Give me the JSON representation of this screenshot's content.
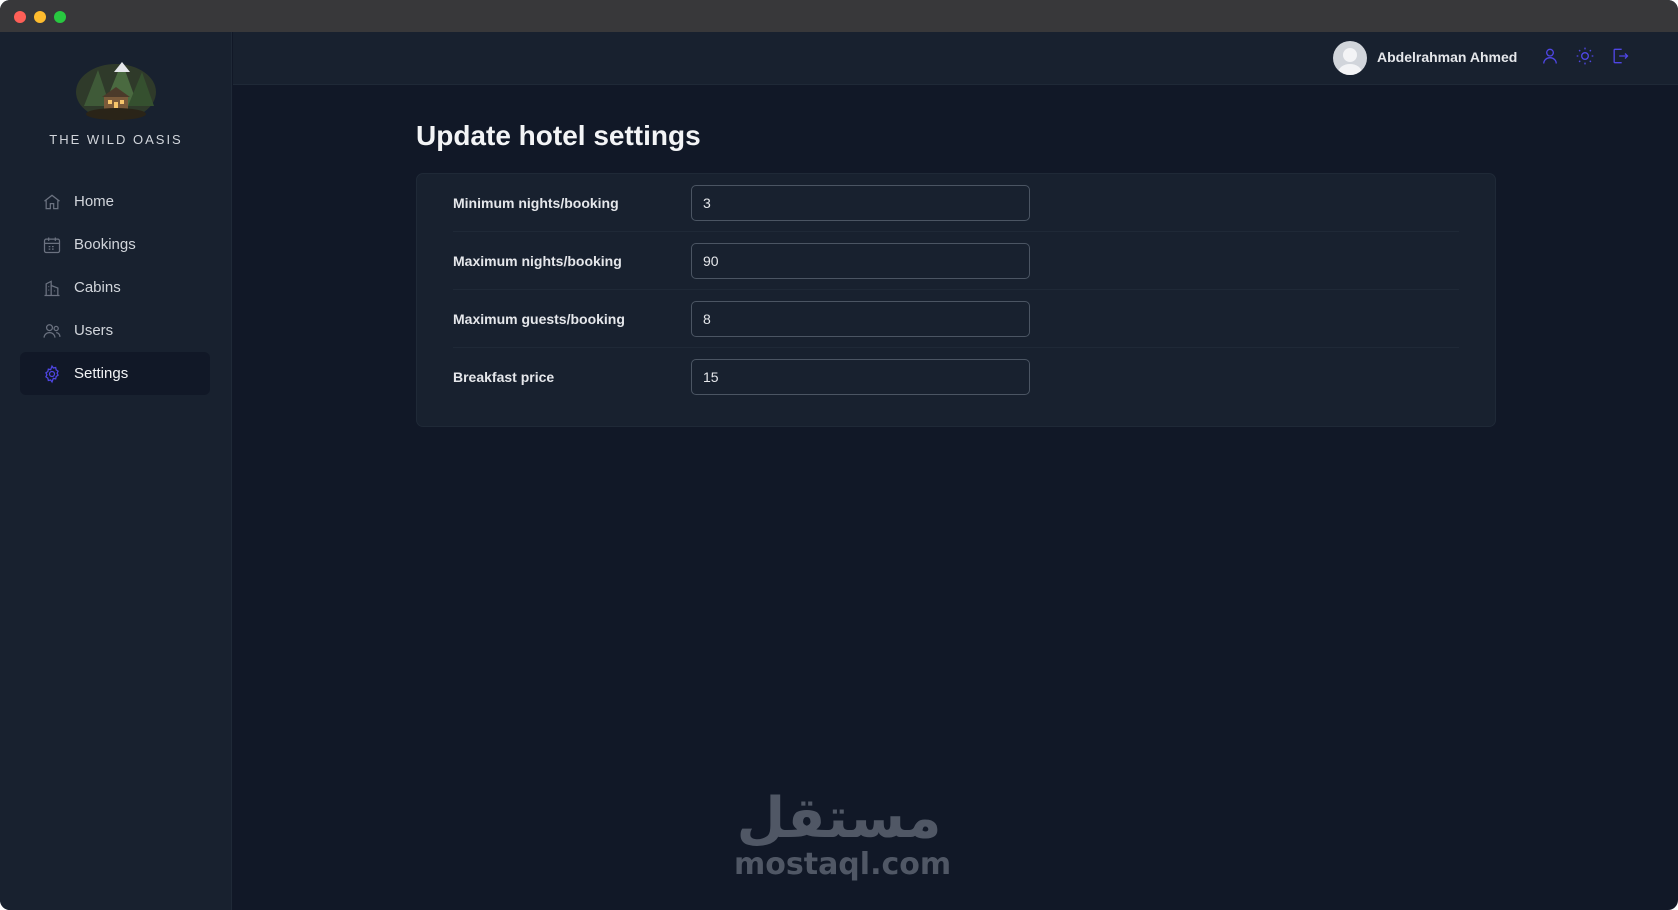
{
  "window": {
    "controls": [
      "close",
      "minimize",
      "maximize"
    ]
  },
  "sidebar": {
    "brand": "THE WILD OASIS",
    "items": [
      {
        "label": "Home",
        "icon": "home-icon",
        "active": false
      },
      {
        "label": "Bookings",
        "icon": "calendar-icon",
        "active": false
      },
      {
        "label": "Cabins",
        "icon": "building-icon",
        "active": false
      },
      {
        "label": "Users",
        "icon": "users-icon",
        "active": false
      },
      {
        "label": "Settings",
        "icon": "gear-icon",
        "active": true
      }
    ]
  },
  "header": {
    "username": "Abdelrahman Ahmed",
    "actions": [
      "user-icon",
      "sun-icon",
      "logout-icon"
    ]
  },
  "main": {
    "title": "Update hotel settings",
    "settings": [
      {
        "label": "Minimum nights/booking",
        "value": "3"
      },
      {
        "label": "Maximum nights/booking",
        "value": "90"
      },
      {
        "label": "Maximum guests/booking",
        "value": "8"
      },
      {
        "label": "Breakfast price",
        "value": "15"
      }
    ]
  },
  "watermark": {
    "arabic": "مستقل",
    "latin": "mostaql.com"
  },
  "colors": {
    "background": "#111827",
    "panel": "#18212f",
    "accent": "#4f46e5",
    "text": "#e5e7eb"
  }
}
